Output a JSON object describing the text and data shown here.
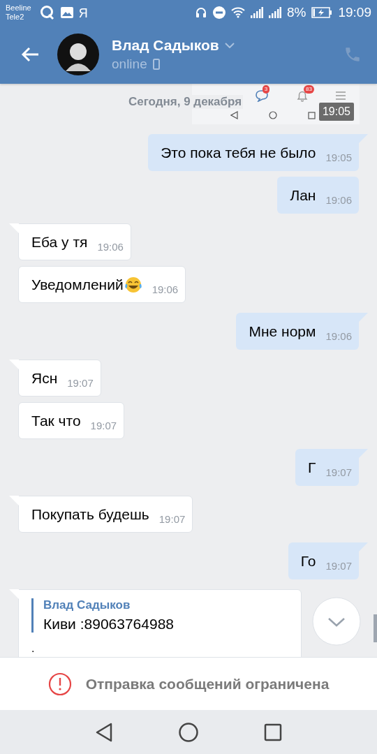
{
  "status_bar": {
    "carriers": [
      "Beeline",
      "Tele2"
    ],
    "app_letter": "Я",
    "battery": "8%",
    "time": "19:09"
  },
  "header": {
    "name": "Влад Садыков",
    "presence": "online"
  },
  "date_label": "Сегодня, 9 декабря",
  "screenshot_fragment": {
    "badges": [
      "3",
      "83"
    ],
    "time": "19:05"
  },
  "messages": [
    {
      "outgoing": true,
      "text": "Это пока тебя не было",
      "time": "19:05"
    },
    {
      "outgoing": true,
      "text": "Лан",
      "time": "19:06"
    },
    {
      "outgoing": false,
      "text": "Еба у тя",
      "time": "19:06"
    },
    {
      "outgoing": false,
      "text": "Уведомлений",
      "emoji_icon": true,
      "time": "19:06"
    },
    {
      "outgoing": true,
      "text": "Мне норм",
      "time": "19:06"
    },
    {
      "outgoing": false,
      "text": "Ясн",
      "time": "19:07"
    },
    {
      "outgoing": false,
      "text": "Так что",
      "time": "19:07"
    },
    {
      "outgoing": true,
      "text": "Г",
      "time": "19:07"
    },
    {
      "outgoing": false,
      "text": "Покупать будешь",
      "time": "19:07"
    },
    {
      "outgoing": true,
      "text": "Го",
      "time": "19:07"
    },
    {
      "outgoing": false,
      "kind": "reply",
      "reply_author": "Влад Садыков",
      "reply_text": "Киви :89063764988",
      "text": "."
    }
  ],
  "notice": "Отправка сообщений ограничена"
}
